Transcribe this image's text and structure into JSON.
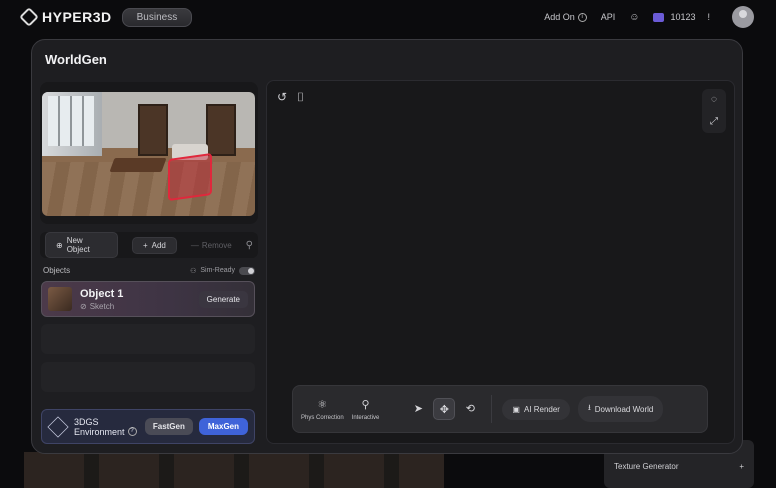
{
  "header": {
    "brand": "HYPER3D",
    "plan": "Business",
    "add_on": "Add On",
    "api": "API",
    "credits": "10123",
    "more": "!"
  },
  "modal": {
    "title": "WorldGen",
    "toolbar": {
      "new_object": "New Object",
      "add": "Add",
      "remove": "Remove"
    },
    "objects_label": "Objects",
    "sim_ready_label": "Sim-Ready",
    "sim_ready_on": true,
    "object": {
      "name": "Object 1",
      "sub": "Sketch",
      "action": "Generate"
    },
    "environment": {
      "line1": "3DGS",
      "line2": "Environment",
      "fast": "FastGen",
      "max": "MaxGen"
    },
    "viewport_tools": {
      "phys": "Phys Correction",
      "interactive": "Interactive",
      "ai_render": "AI Render",
      "download": "Download World"
    }
  },
  "background": {
    "texture_generator": "Texture Generator"
  },
  "colors": {
    "accent_blue": "#3f63d9",
    "selection_red": "#e0283c"
  }
}
